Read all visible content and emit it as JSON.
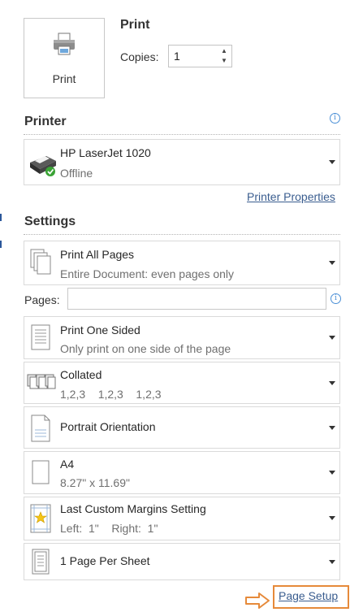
{
  "print": {
    "button_label": "Print",
    "section_title": "Print",
    "copies_label": "Copies:",
    "copies_value": "1"
  },
  "printer": {
    "section_title": "Printer",
    "name": "HP LaserJet 1020",
    "status": "Offline",
    "properties_link": "Printer Properties"
  },
  "settings": {
    "section_title": "Settings",
    "pages_label": "Pages:",
    "pages_value": "",
    "items": [
      {
        "title": "Print All Pages",
        "subtitle": "Entire Document: even pages only",
        "icon": "pages-icon"
      },
      {
        "title": "Print One Sided",
        "subtitle": "Only print on one side of the page",
        "icon": "one-sided-icon"
      },
      {
        "title": "Collated",
        "subtitle": "1,2,3    1,2,3    1,2,3",
        "icon": "collated-icon"
      },
      {
        "title": "Portrait Orientation",
        "subtitle": "",
        "icon": "portrait-icon"
      },
      {
        "title": "A4",
        "subtitle": "8.27\" x 11.69\"",
        "icon": "paper-size-icon"
      },
      {
        "title": "Last Custom Margins Setting",
        "subtitle": "Left:  1\"    Right:  1\"",
        "icon": "margins-icon"
      },
      {
        "title": "1 Page Per Sheet",
        "subtitle": "",
        "icon": "pages-per-sheet-icon"
      }
    ]
  },
  "page_setup_link": "Page Setup",
  "colors": {
    "link": "#3a5d8f",
    "info_icon": "#4a8fd6",
    "highlight_orange": "#e68a3a",
    "status_green": "#3aa335"
  }
}
